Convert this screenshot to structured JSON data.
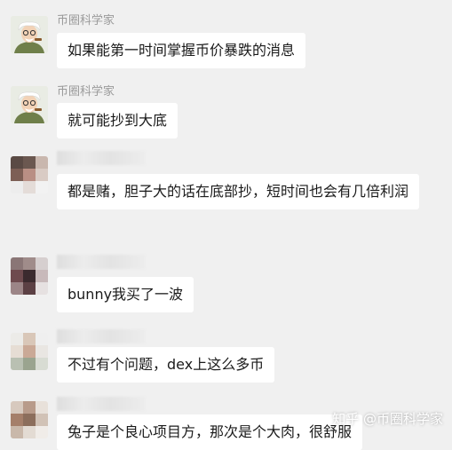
{
  "messages": [
    {
      "sender": "币圈科学家",
      "text": "如果能第一时间掌握币价暴跌的消息"
    },
    {
      "sender": "币圈科学家",
      "text": "就可能抄到大底"
    },
    {
      "sender": "",
      "text": "都是赌，胆子大的话在底部抄，短时间也会有几倍利润"
    },
    {
      "sender": "",
      "text": "bunny我买了一波"
    },
    {
      "sender": "",
      "text": "不过有个问题，dex上这么多币"
    },
    {
      "sender": "",
      "text": "兔子是个良心项目方，那次是个大肉，很舒服"
    }
  ],
  "watermark": "知乎 @币圈科学家",
  "colors": {
    "background": "#f0f0f0",
    "bubble": "#ffffff",
    "sender_name": "#9a9a9a"
  },
  "avatars": {
    "sci": "scientist-cartoon-avatar",
    "others": "pixelated-avatar"
  }
}
